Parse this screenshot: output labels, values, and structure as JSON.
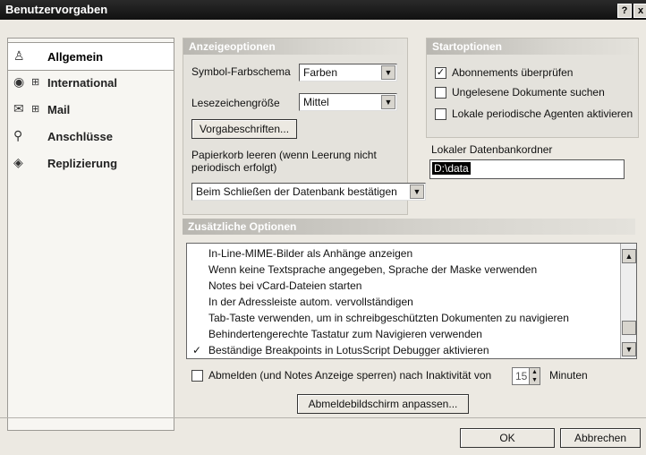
{
  "window": {
    "title": "Benutzervorgaben",
    "help_glyph": "?",
    "close_glyph": "x"
  },
  "sidebar": {
    "items": [
      {
        "icon": "person-icon",
        "expander": "",
        "label": "Allgemein"
      },
      {
        "icon": "globe-icon",
        "expander": "⊞",
        "label": "International"
      },
      {
        "icon": "mail-icon",
        "expander": "⊞",
        "label": "Mail"
      },
      {
        "icon": "connection-icon",
        "expander": "",
        "label": "Anschlüsse"
      },
      {
        "icon": "replication-icon",
        "expander": "",
        "label": "Replizierung"
      }
    ]
  },
  "anzeige": {
    "header": "Anzeigeoptionen",
    "farbschema_label": "Symbol-Farbschema",
    "farbschema_value": "Farben",
    "lesezeichen_label": "Lesezeichengröße",
    "lesezeichen_value": "Mittel",
    "vorgabe_button": "Vorgabeschriften...",
    "papierkorb_label_1": "Papierkorb leeren (wenn Leerung nicht",
    "papierkorb_label_2": "periodisch erfolgt)",
    "papierkorb_value": "Beim Schließen der Datenbank bestätigen"
  },
  "start": {
    "header": "Startoptionen",
    "options": [
      {
        "checked": true,
        "label": "Abonnements überprüfen"
      },
      {
        "checked": false,
        "label": "Ungelesene Dokumente suchen"
      },
      {
        "checked": false,
        "label": "Lokale periodische Agenten aktivieren"
      }
    ],
    "ordner_label": "Lokaler Datenbankordner",
    "ordner_value": "D:\\data"
  },
  "zusatz": {
    "header": "Zusätzliche Optionen",
    "items": [
      {
        "checked": false,
        "label": "In-Line-MIME-Bilder als Anhänge anzeigen"
      },
      {
        "checked": false,
        "label": "Wenn keine Textsprache angegeben, Sprache der Maske verwenden"
      },
      {
        "checked": false,
        "label": "Notes bei vCard-Dateien starten"
      },
      {
        "checked": false,
        "label": "In der Adressleiste autom. vervollständigen"
      },
      {
        "checked": false,
        "label": "Tab-Taste verwenden, um in schreibgeschützten Dokumenten zu navigieren"
      },
      {
        "checked": false,
        "label": "Behindertengerechte Tastatur zum Navigieren verwenden"
      },
      {
        "checked": true,
        "label": "Beständige Breakpoints in LotusScript Debugger aktivieren"
      }
    ]
  },
  "abmelden": {
    "label": "Abmelden (und Notes Anzeige sperren) nach Inaktivität von",
    "minutes_value": "15",
    "unit": "Minuten",
    "button": "Abmeldebildschirm anpassen..."
  },
  "footer": {
    "ok": "OK",
    "cancel": "Abbrechen"
  }
}
